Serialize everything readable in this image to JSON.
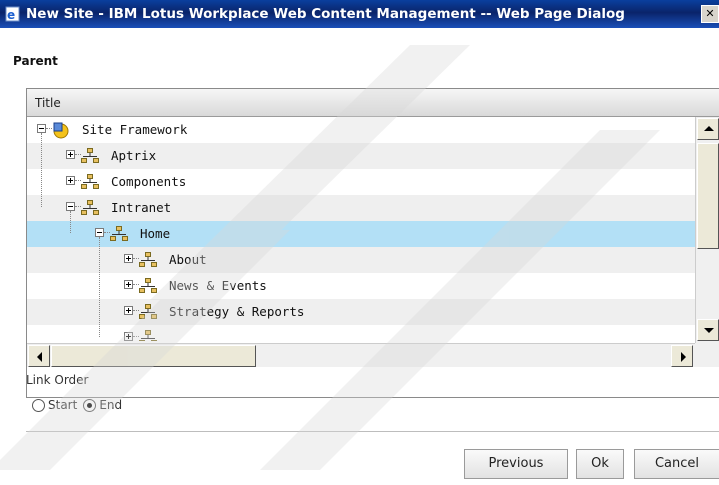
{
  "window": {
    "title": "New Site - IBM Lotus Workplace Web Content Management -- Web Page Dialog",
    "icon": "ie-page-icon",
    "close_glyph": "✕"
  },
  "section_label": "Parent",
  "tree": {
    "column_header": "Title",
    "rows": [
      {
        "label": "Site Framework",
        "level": 0,
        "expander": "minus",
        "icon": "site-framework-icon",
        "selected": false
      },
      {
        "label": "Aptrix",
        "level": 1,
        "expander": "plus",
        "icon": "site-icon",
        "selected": false
      },
      {
        "label": "Components",
        "level": 1,
        "expander": "plus",
        "icon": "site-icon",
        "selected": false
      },
      {
        "label": "Intranet",
        "level": 1,
        "expander": "minus",
        "icon": "site-icon",
        "selected": false
      },
      {
        "label": "Home",
        "level": 2,
        "expander": "minus",
        "icon": "site-icon",
        "selected": true
      },
      {
        "label": "About",
        "level": 3,
        "expander": "plus",
        "icon": "site-icon",
        "selected": false
      },
      {
        "label": "News & Events",
        "level": 3,
        "expander": "plus",
        "icon": "site-icon",
        "selected": false
      },
      {
        "label": "Strategy & Reports",
        "level": 3,
        "expander": "plus",
        "icon": "site-icon",
        "selected": false
      },
      {
        "label": "",
        "level": 3,
        "expander": "plus",
        "icon": "site-icon",
        "selected": false
      }
    ]
  },
  "link_order": {
    "label": "Link Order",
    "options": [
      {
        "label": "Start",
        "checked": false
      },
      {
        "label": "End",
        "checked": true
      }
    ]
  },
  "buttons": {
    "previous": "Previous",
    "ok": "Ok",
    "cancel": "Cancel"
  },
  "colors": {
    "titlebar": "#0a246a",
    "selected_row": "#b3e0f6",
    "alt_row": "#efefef"
  }
}
